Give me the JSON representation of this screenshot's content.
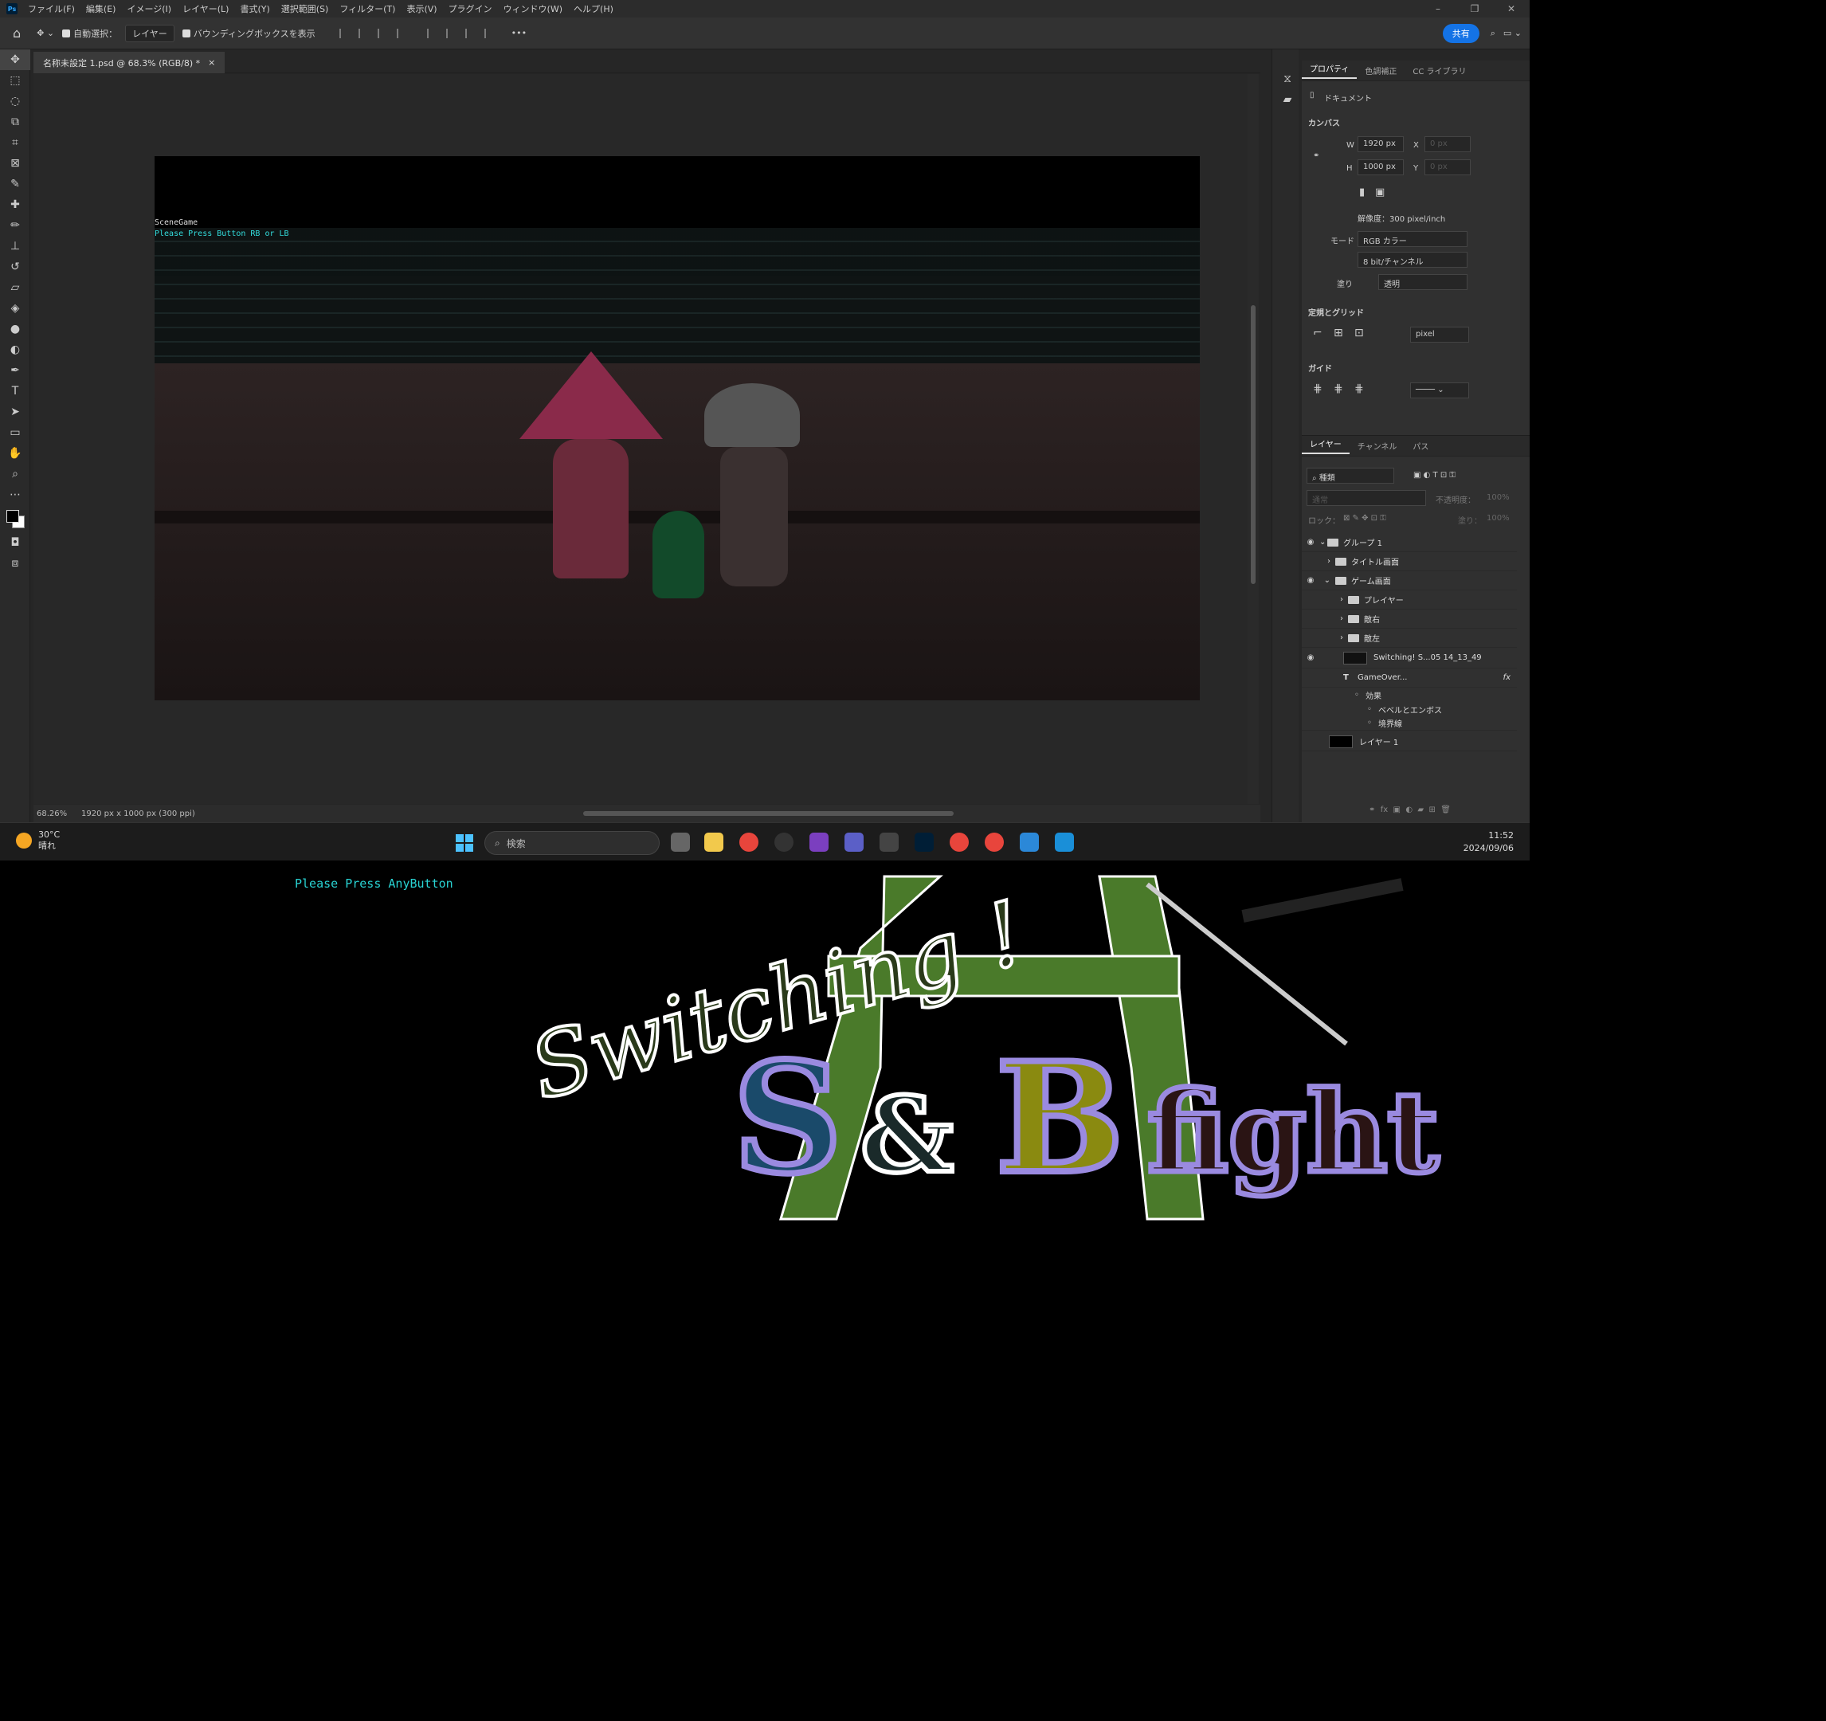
{
  "app": {
    "logo_text": "Ps",
    "menus": [
      "ファイル(F)",
      "編集(E)",
      "イメージ(I)",
      "レイヤー(L)",
      "書式(Y)",
      "選択範囲(S)",
      "フィルター(T)",
      "表示(V)",
      "プラグイン",
      "ウィンドウ(W)",
      "ヘルプ(H)"
    ],
    "window_controls": {
      "min": "–",
      "max": "❐",
      "close": "✕"
    }
  },
  "options": {
    "auto_select_label": "自動選択：",
    "auto_select_target": "レイヤー",
    "bbox_label": "バウンディングボックスを表示",
    "more": "•••",
    "share": "共有"
  },
  "document": {
    "tab_title": "名称未設定 1.psd @ 68.3% (RGB/8) *",
    "close": "×",
    "zoom": "68.26%",
    "size_info": "1920 px x 1000 px (300 ppi)"
  },
  "game": {
    "hud_scene": "SceneGame",
    "hud_hint": "Please Press Button RB or LB"
  },
  "properties": {
    "tabs": [
      "プロパティ",
      "色調補正",
      "CC ライブラリ"
    ],
    "doc_label": "ドキュメント",
    "canvas_header": "カンバス",
    "w_label": "W",
    "w_value": "1920 px",
    "h_label": "H",
    "h_value": "1000 px",
    "x_label": "X",
    "x_value": "0 px",
    "y_label": "Y",
    "y_value": "0 px",
    "resolution": "解像度：300 pixel/inch",
    "mode_label": "モード",
    "mode_value": "RGB カラー",
    "depth_value": "8 bit/チャンネル",
    "fill_label": "塗り",
    "fill_value": "透明",
    "rulers_header": "定規とグリッド",
    "unit_value": "pixel",
    "guides_header": "ガイド"
  },
  "layers": {
    "tabs": [
      "レイヤー",
      "チャンネル",
      "パス"
    ],
    "filter_label": "種類",
    "blend": "通常",
    "opacity_label": "不透明度：",
    "opacity_value": "100%",
    "lock_label": "ロック：",
    "fill_label": "塗り：",
    "fill_value": "100%",
    "items": [
      {
        "name": "グループ 1",
        "type": "group",
        "visible": true
      },
      {
        "name": "タイトル画面",
        "type": "group",
        "visible": false
      },
      {
        "name": "ゲーム画面",
        "type": "group",
        "visible": true
      },
      {
        "name": "プレイヤー",
        "type": "group",
        "visible": false
      },
      {
        "name": "敵右",
        "type": "group",
        "visible": false
      },
      {
        "name": "敵左",
        "type": "group",
        "visible": false
      },
      {
        "name": "Switching! S...05 14_13_49",
        "type": "image",
        "visible": true
      },
      {
        "name": "GameOver...",
        "type": "text",
        "visible": false
      },
      {
        "name": "効果",
        "type": "effect",
        "visible": true
      },
      {
        "name": "ベベルとエンボス",
        "type": "effect",
        "visible": true
      },
      {
        "name": "境界線",
        "type": "effect",
        "visible": true
      },
      {
        "name": "レイヤー 1",
        "type": "fill",
        "visible": false
      }
    ],
    "fx": "fx"
  },
  "taskbar": {
    "temp": "30°C",
    "weather": "晴れ",
    "search": "検索",
    "time": "11:52",
    "date": "2024/09/06"
  },
  "title_screen": {
    "prompt": "Please Press AnyButton",
    "logo_script": "Switching !",
    "logo_s": "S",
    "logo_amp": "&",
    "logo_b": "B",
    "logo_fight": "fight"
  },
  "colors": {
    "accent": "#1473e6",
    "hud_cyan": "#29d3d3",
    "logo_green": "#4a7a2a",
    "logo_s": "#1a4a6a",
    "logo_b": "#8a8a10",
    "logo_outline": "#9a8ae0"
  }
}
